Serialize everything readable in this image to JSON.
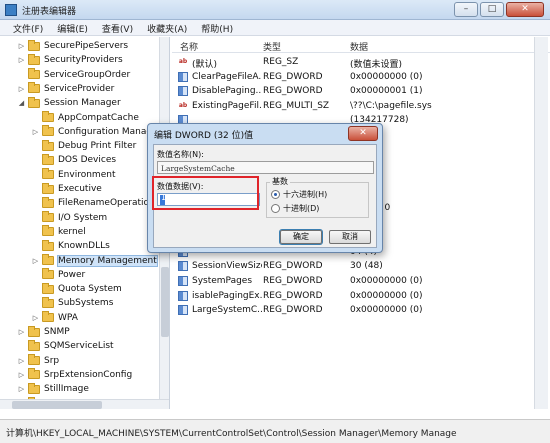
{
  "window": {
    "title": "注册表编辑器",
    "buttons": [
      "–",
      "□",
      "✕"
    ]
  },
  "menubar": [
    "文件(F)",
    "编辑(E)",
    "查看(V)",
    "收藏夹(A)",
    "帮助(H)"
  ],
  "tree": [
    {
      "label": "SecurePipeServers",
      "depth": 1,
      "expander": "▷"
    },
    {
      "label": "SecurityProviders",
      "depth": 1,
      "expander": "▷"
    },
    {
      "label": "ServiceGroupOrder",
      "depth": 1,
      "expander": ""
    },
    {
      "label": "ServiceProvider",
      "depth": 1,
      "expander": "▷"
    },
    {
      "label": "Session Manager",
      "depth": 1,
      "expander": "◢"
    },
    {
      "label": "AppCompatCache",
      "depth": 2,
      "expander": ""
    },
    {
      "label": "Configuration Manag",
      "depth": 2,
      "expander": "▷"
    },
    {
      "label": "Debug Print Filter",
      "depth": 2,
      "expander": ""
    },
    {
      "label": "DOS Devices",
      "depth": 2,
      "expander": ""
    },
    {
      "label": "Environment",
      "depth": 2,
      "expander": ""
    },
    {
      "label": "Executive",
      "depth": 2,
      "expander": ""
    },
    {
      "label": "FileRenameOperation",
      "depth": 2,
      "expander": ""
    },
    {
      "label": "I/O System",
      "depth": 2,
      "expander": ""
    },
    {
      "label": "kernel",
      "depth": 2,
      "expander": ""
    },
    {
      "label": "KnownDLLs",
      "depth": 2,
      "expander": ""
    },
    {
      "label": "Memory Management",
      "depth": 2,
      "expander": "▷",
      "selected": true
    },
    {
      "label": "Power",
      "depth": 2,
      "expander": ""
    },
    {
      "label": "Quota System",
      "depth": 2,
      "expander": ""
    },
    {
      "label": "SubSystems",
      "depth": 2,
      "expander": ""
    },
    {
      "label": "WPA",
      "depth": 2,
      "expander": "▷"
    },
    {
      "label": "SNMP",
      "depth": 1,
      "expander": "▷"
    },
    {
      "label": "SQMServiceList",
      "depth": 1,
      "expander": ""
    },
    {
      "label": "Srp",
      "depth": 1,
      "expander": "▷"
    },
    {
      "label": "SrpExtensionConfig",
      "depth": 1,
      "expander": "▷"
    },
    {
      "label": "StillImage",
      "depth": 1,
      "expander": "▷"
    },
    {
      "label": "Storage",
      "depth": 1,
      "expander": "▷"
    }
  ],
  "values": {
    "headers": [
      "名称",
      "类型",
      "数据"
    ],
    "rows": [
      {
        "icon": "sz",
        "name": "(默认)",
        "type": "REG_SZ",
        "data": "(数值未设置)"
      },
      {
        "icon": "dw",
        "name": "ClearPageFileA...",
        "type": "REG_DWORD",
        "data": "0x00000000 (0)"
      },
      {
        "icon": "dw",
        "name": "DisablePaging...",
        "type": "REG_DWORD",
        "data": "0x00000001 (1)"
      },
      {
        "icon": "sz",
        "name": "ExistingPageFil...",
        "type": "REG_MULTI_SZ",
        "data": "\\??\\C:\\pagefile.sys"
      },
      {
        "icon": "dw",
        "name": "",
        "type": "",
        "data": "(134217728)"
      },
      {
        "icon": "dw",
        "name": "",
        "type": "",
        "data": "(0)"
      },
      {
        "icon": "dw",
        "name": "",
        "type": "",
        "data": "(0)"
      },
      {
        "icon": "dw",
        "name": "",
        "type": "",
        "data": "(0)"
      },
      {
        "icon": "dw",
        "name": "",
        "type": "",
        "data": "(0)"
      },
      {
        "icon": "dw",
        "name": "",
        "type": "",
        "data": "(0)"
      },
      {
        "icon": "sz",
        "name": "",
        "type": "",
        "data": "e.sys 0 0"
      },
      {
        "icon": "dw",
        "name": "",
        "type": "",
        "data": "01 (1)"
      },
      {
        "icon": "dw",
        "name": "",
        "type": "",
        "data": "(0)"
      },
      {
        "icon": "dw",
        "name": "",
        "type": "",
        "data": "04 (4)"
      },
      {
        "icon": "dw",
        "name": "SessionViewSize",
        "type": "REG_DWORD",
        "data": "30 (48)"
      },
      {
        "icon": "dw",
        "name": "SystemPages",
        "type": "REG_DWORD",
        "data": "0x00000000 (0)"
      },
      {
        "icon": "dw",
        "name": "isablePagingEx...",
        "type": "REG_DWORD",
        "data": "0x00000000 (0)"
      },
      {
        "icon": "dw",
        "name": "LargeSystemC...",
        "type": "REG_DWORD",
        "data": "0x00000000 (0)"
      }
    ]
  },
  "dialog": {
    "title": "编辑 DWORD (32 位)值",
    "close": "✕",
    "name_label": "数值名称(N):",
    "name_value": "LargeSystemCache",
    "data_label": "数值数据(V):",
    "data_value": "1",
    "base_label": "基数",
    "radio_hex": "十六进制(H)",
    "radio_dec": "十进制(D)",
    "ok": "确定",
    "cancel": "取消",
    "selected_base": "hex"
  },
  "statusbar": "计算机\\HKEY_LOCAL_MACHINE\\SYSTEM\\CurrentControlSet\\Control\\Session Manager\\Memory Manage"
}
